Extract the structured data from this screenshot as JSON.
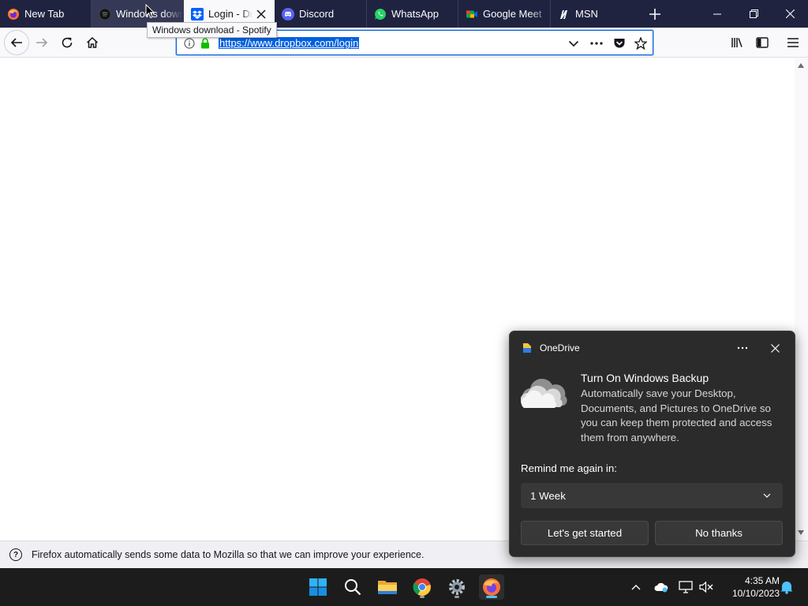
{
  "tabs": [
    {
      "label": "New Tab",
      "icon": "firefox-icon"
    },
    {
      "label": "Windows download - Spotify",
      "icon": "spotify-icon"
    },
    {
      "label": "Login - Dropbox",
      "icon": "dropbox-icon",
      "active": true
    },
    {
      "label": "Discord",
      "icon": "discord-icon"
    },
    {
      "label": "WhatsApp",
      "icon": "whatsapp-icon"
    },
    {
      "label": "Google Meet",
      "icon": "google-meet-icon"
    },
    {
      "label": "MSN",
      "icon": "msn-icon"
    }
  ],
  "tooltip": "Windows download - Spotify",
  "url": "https://www.dropbox.com/login",
  "notification": {
    "message": "Firefox automatically sends some data to Mozilla so that we can improve your experience."
  },
  "onedrive": {
    "app_name": "OneDrive",
    "title": "Turn On Windows Backup",
    "body": "Automatically save your Desktop, Documents, and Pictures to OneDrive so you can keep them protected and access them from anywhere.",
    "remind_label": "Remind me again in:",
    "remind_value": "1 Week",
    "primary_button": "Let's get started",
    "secondary_button": "No thanks"
  },
  "taskbar": {
    "time": "4:35 AM",
    "date": "10/10/2023"
  },
  "colors": {
    "tabbar": "#202340",
    "accent": "#0060df",
    "popup_bg": "#2b2b2b",
    "taskbar": "#1c1c1c"
  }
}
